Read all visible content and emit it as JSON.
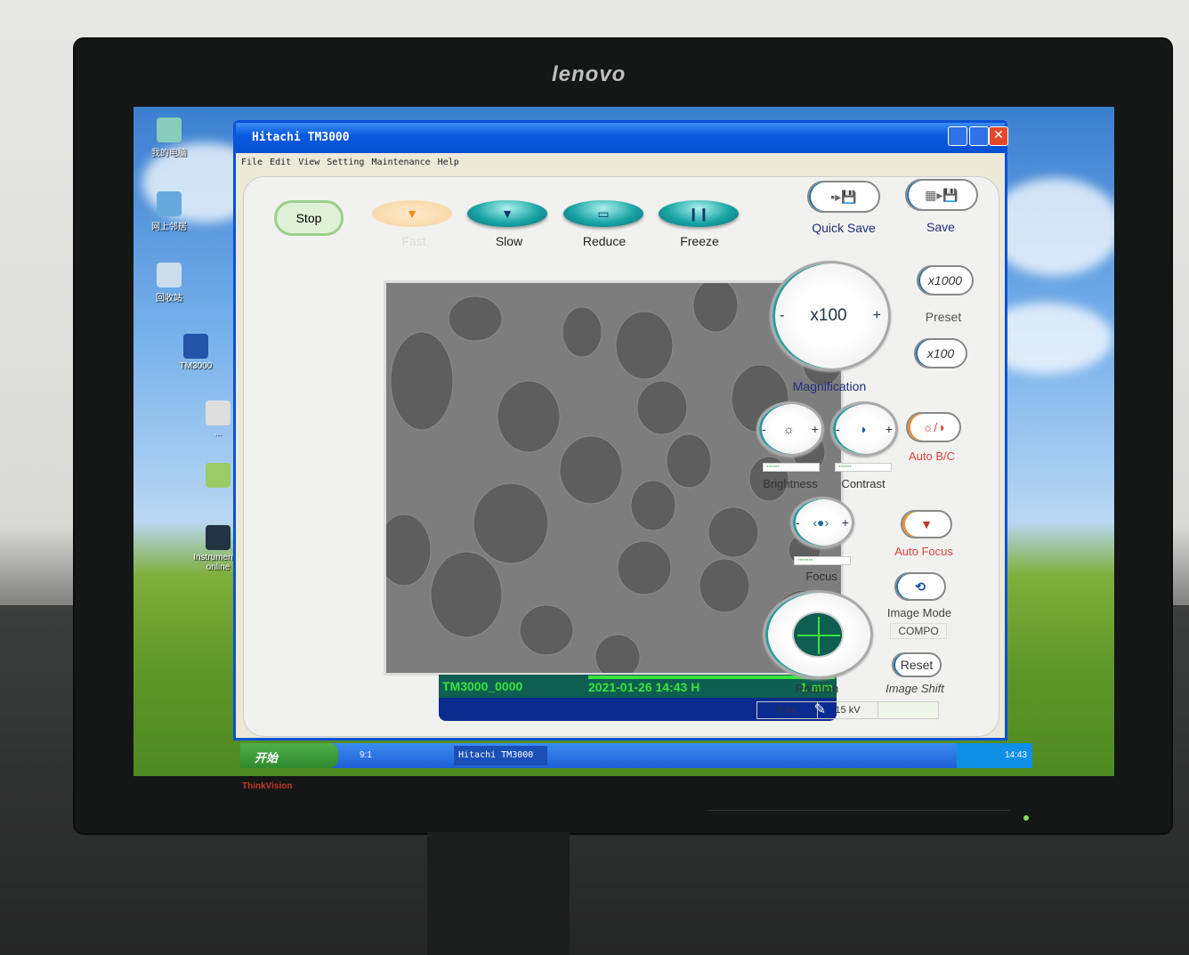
{
  "monitor": {
    "brand": "lenovo",
    "model_logo": "ThinkVision"
  },
  "desktop": {
    "icons": [
      "我的电脑",
      "网上邻居",
      "回收站",
      "TM3000",
      "...",
      "",
      "Instrument 1 online"
    ]
  },
  "window": {
    "title": "Hitachi TM3000",
    "menu": [
      "File",
      "Edit",
      "View",
      "Setting",
      "Maintenance",
      "Help"
    ],
    "scan": {
      "stop": "Stop",
      "fast": "Fast",
      "slow": "Slow",
      "reduce": "Reduce",
      "freeze": "Freeze"
    },
    "save": {
      "quick_save": "Quick Save",
      "save": "Save"
    },
    "magnification": {
      "value": "x100",
      "minus": "-",
      "plus": "+",
      "label": "Magnification"
    },
    "preset": {
      "high": "x1000",
      "label": "Preset",
      "low": "x100"
    },
    "brightness": {
      "label": "Brightness"
    },
    "contrast": {
      "label": "Contrast"
    },
    "auto_bc": {
      "label": "Auto B/C"
    },
    "focus": {
      "label": "Focus"
    },
    "auto_focus": {
      "label": "Auto Focus"
    },
    "image_mode": {
      "label": "Image Mode",
      "value": "COMPO"
    },
    "rotation": {
      "label": "Rotation"
    },
    "image_shift": {
      "reset": "Reset",
      "label": "Image Shift"
    },
    "voltage": [
      "5 kV",
      "15 kV",
      ""
    ],
    "image_status": {
      "name": "TM3000_0000",
      "datetime": "2021-01-26 14:43 H",
      "scale": "1 mm"
    }
  },
  "taskbar": {
    "start": "开始",
    "quick": "9:1",
    "task": "Hitachi TM3000",
    "clock": "14:43"
  },
  "colors": {
    "title_bar": "#0a5ae0",
    "scan_buttons": "#19a5a6",
    "status_text": "#39e43c",
    "auto_label": "#d9443a"
  }
}
